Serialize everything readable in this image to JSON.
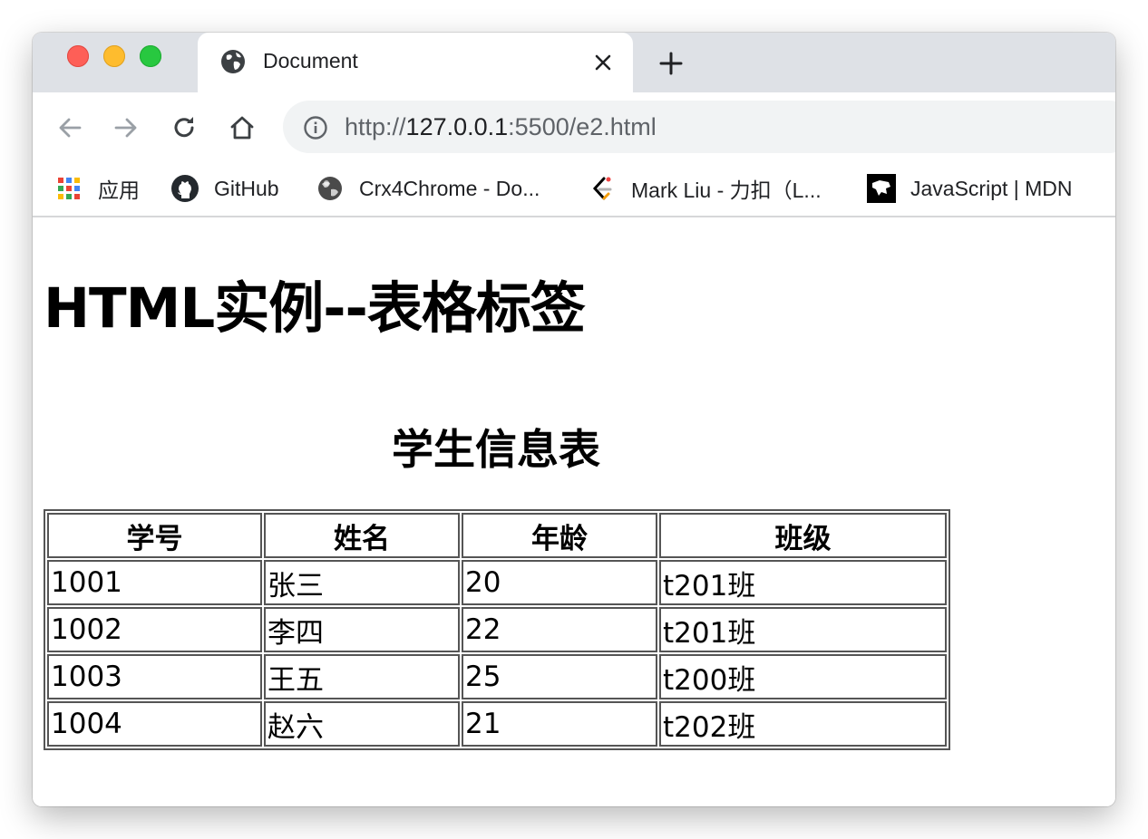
{
  "browser": {
    "tab": {
      "title": "Document"
    },
    "address": {
      "prefix": "http://",
      "host": "127.0.0.1",
      "rest": ":5500/e2.html"
    },
    "bookmarks": [
      {
        "label": "应用",
        "icon": "apps-grid-icon"
      },
      {
        "label": "GitHub",
        "icon": "github-icon"
      },
      {
        "label": "Crx4Chrome - Do...",
        "icon": "globe-icon"
      },
      {
        "label": "Mark Liu - 力扣（L...",
        "icon": "leetcode-icon"
      },
      {
        "label": "JavaScript | MDN",
        "icon": "mdn-icon"
      }
    ]
  },
  "page": {
    "heading": "HTML实例--表格标签",
    "table": {
      "caption": "学生信息表",
      "headers": [
        "学号",
        "姓名",
        "年龄",
        "班级"
      ],
      "rows": [
        [
          "1001",
          "张三",
          "20",
          "t201班"
        ],
        [
          "1002",
          "李四",
          "22",
          "t201班"
        ],
        [
          "1003",
          "王五",
          "25",
          "t200班"
        ],
        [
          "1004",
          "赵六",
          "21",
          "t202班"
        ]
      ]
    }
  }
}
